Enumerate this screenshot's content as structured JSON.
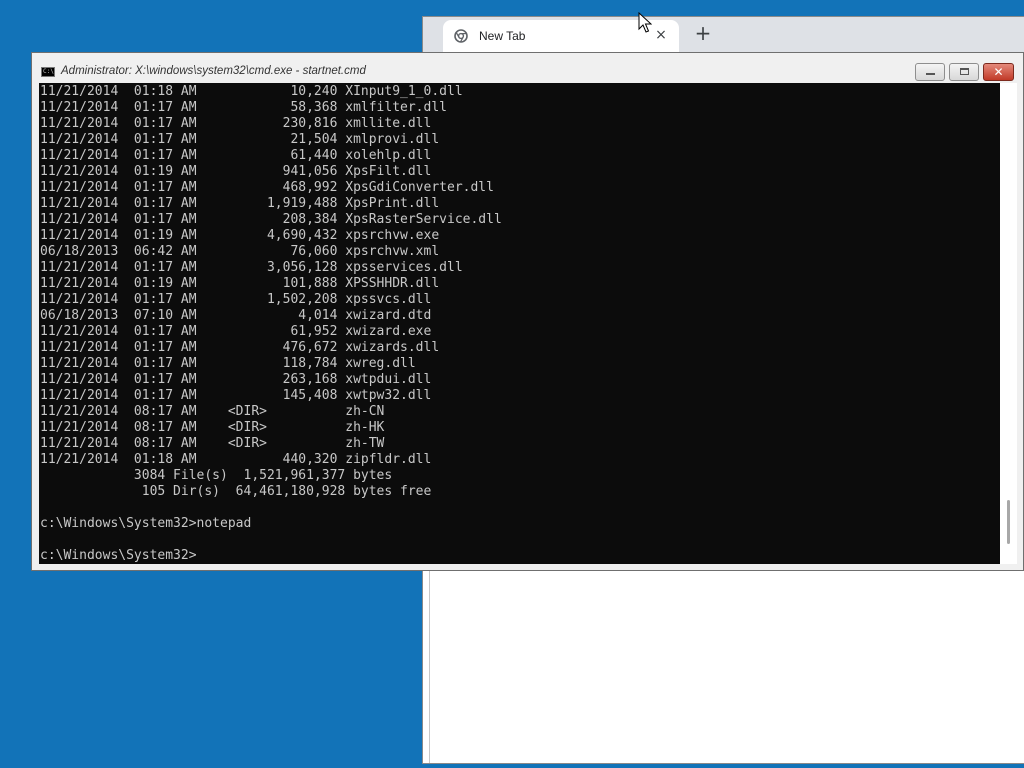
{
  "browser": {
    "tab": {
      "title": "New Tab",
      "close_glyph": "×"
    },
    "new_tab_glyph": "+"
  },
  "cmd": {
    "title": "Administrator: X:\\windows\\system32\\cmd.exe - startnet.cmd",
    "icon_label": "C:\\",
    "close_glyph": "✕",
    "lines": [
      "11/21/2014  01:18 AM            10,240 XInput9_1_0.dll",
      "11/21/2014  01:17 AM            58,368 xmlfilter.dll",
      "11/21/2014  01:17 AM           230,816 xmllite.dll",
      "11/21/2014  01:17 AM            21,504 xmlprovi.dll",
      "11/21/2014  01:17 AM            61,440 xolehlp.dll",
      "11/21/2014  01:19 AM           941,056 XpsFilt.dll",
      "11/21/2014  01:17 AM           468,992 XpsGdiConverter.dll",
      "11/21/2014  01:17 AM         1,919,488 XpsPrint.dll",
      "11/21/2014  01:17 AM           208,384 XpsRasterService.dll",
      "11/21/2014  01:19 AM         4,690,432 xpsrchvw.exe",
      "06/18/2013  06:42 AM            76,060 xpsrchvw.xml",
      "11/21/2014  01:17 AM         3,056,128 xpsservices.dll",
      "11/21/2014  01:19 AM           101,888 XPSSHHDR.dll",
      "11/21/2014  01:17 AM         1,502,208 xpssvcs.dll",
      "06/18/2013  07:10 AM             4,014 xwizard.dtd",
      "11/21/2014  01:17 AM            61,952 xwizard.exe",
      "11/21/2014  01:17 AM           476,672 xwizards.dll",
      "11/21/2014  01:17 AM           118,784 xwreg.dll",
      "11/21/2014  01:17 AM           263,168 xwtpdui.dll",
      "11/21/2014  01:17 AM           145,408 xwtpw32.dll",
      "11/21/2014  08:17 AM    <DIR>          zh-CN",
      "11/21/2014  08:17 AM    <DIR>          zh-HK",
      "11/21/2014  08:17 AM    <DIR>          zh-TW",
      "11/21/2014  01:18 AM           440,320 zipfldr.dll",
      "            3084 File(s)  1,521,961,377 bytes",
      "             105 Dir(s)  64,461,180,928 bytes free",
      "",
      "c:\\Windows\\System32>notepad",
      "",
      "c:\\Windows\\System32>"
    ]
  },
  "colors": {
    "desktop": "#1273b8",
    "console_bg": "#0c0c0c",
    "console_fg": "#c8c8c8"
  },
  "icons": {
    "tab_favicon": "chrome-logo-icon",
    "cursor": "arrow-cursor-icon"
  }
}
